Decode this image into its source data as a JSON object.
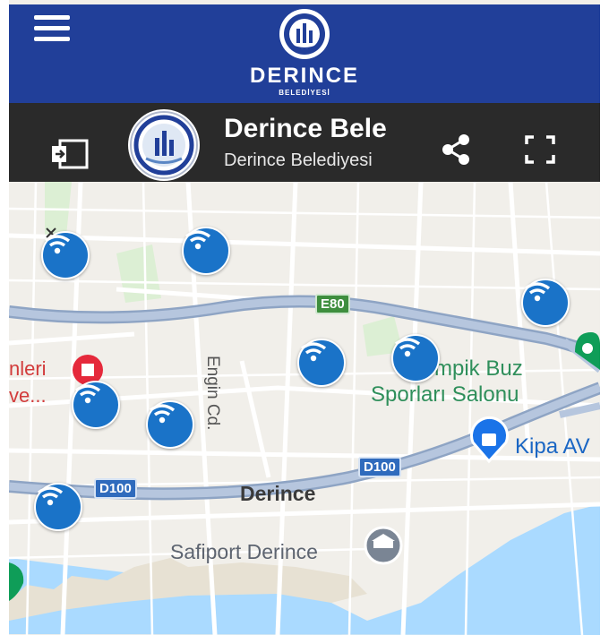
{
  "header": {
    "brand_name": "DERINCE",
    "brand_sub": "BELEDİYESİ"
  },
  "titlebar": {
    "title": "Derince Bele",
    "subtitle": "Derince Belediyesi"
  },
  "map": {
    "road_badges": {
      "e80": "E80",
      "d100_right": "D100",
      "d100_left": "D100"
    },
    "labels": {
      "street": "Engin Cd.",
      "district": "Derince",
      "poi_left_1": "nleri",
      "poi_left_2": "ve...",
      "poi_sport_1": "mpik Buz",
      "poi_sport_2": "Sporları Salonu",
      "poi_shop": "Kipa AV",
      "poi_port": "Safiport Derince"
    },
    "colors": {
      "wifi_marker": "#1a73c8",
      "topbar": "#213f99",
      "sea": "#aadaff",
      "poi_green": "#0f9d58"
    }
  }
}
